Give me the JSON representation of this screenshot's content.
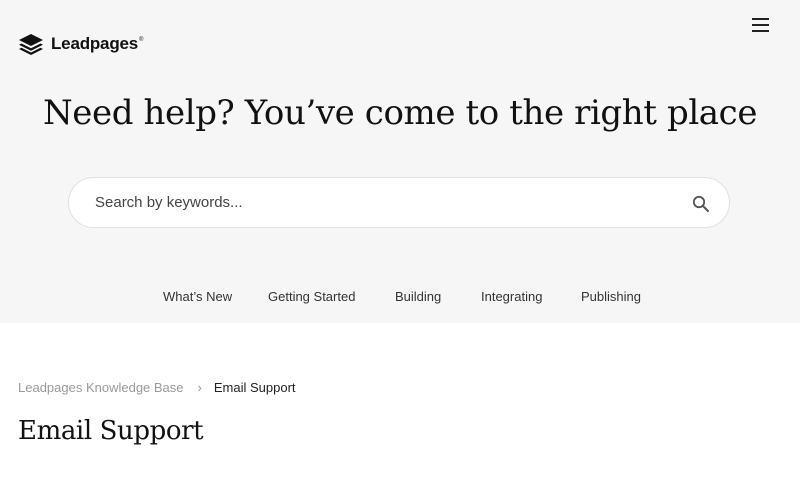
{
  "header": {
    "logo_text": "Leadpages",
    "logo_mark": "®",
    "logo_icon": "stacked-layers-icon",
    "menu_icon": "hamburger-menu-icon"
  },
  "hero": {
    "headline": "Need help? You’ve come to the right place",
    "background_color": "#f6f6f6"
  },
  "search": {
    "placeholder": "Search by keywords...",
    "value": "",
    "icon": "search-icon"
  },
  "nav": {
    "items": [
      {
        "label": "What’s New"
      },
      {
        "label": "Getting Started"
      },
      {
        "label": "Building"
      },
      {
        "label": "Integrating"
      },
      {
        "label": "Publishing"
      }
    ]
  },
  "breadcrumb": {
    "root": "Leadpages Knowledge Base",
    "separator": "›",
    "current": "Email Support"
  },
  "page": {
    "title": "Email Support"
  }
}
